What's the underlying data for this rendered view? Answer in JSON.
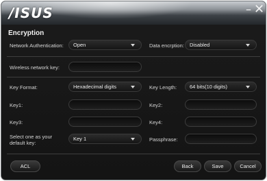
{
  "window": {
    "brand": "/ISUS",
    "minimize_glyph": "–",
    "close_glyph": "✕"
  },
  "section_title": "Encryption",
  "network_auth": {
    "label": "Network Authentication:",
    "value": "Open"
  },
  "data_encryption": {
    "label": "Data encrption:",
    "value": "Disabled"
  },
  "wireless_key": {
    "label": "Wireless network key:",
    "value": ""
  },
  "key_format": {
    "label": "Key Format:",
    "value": "Hexadecimal digits"
  },
  "key_length": {
    "label": "Key Length:",
    "value": "64 bits(10 digits)"
  },
  "key1": {
    "label": "Key1:",
    "value": ""
  },
  "key2": {
    "label": "Key2:",
    "value": ""
  },
  "key3": {
    "label": "Key3:",
    "value": ""
  },
  "key4": {
    "label": "Key4:",
    "value": ""
  },
  "default_key": {
    "label_line1": "Select one as your",
    "label_line2": "default key:",
    "value": "Key 1"
  },
  "passphrase": {
    "label": "Passphrase:",
    "value": ""
  },
  "buttons": {
    "acl": "ACL",
    "back": "Back",
    "save": "Save",
    "cancel": "Cancel"
  }
}
